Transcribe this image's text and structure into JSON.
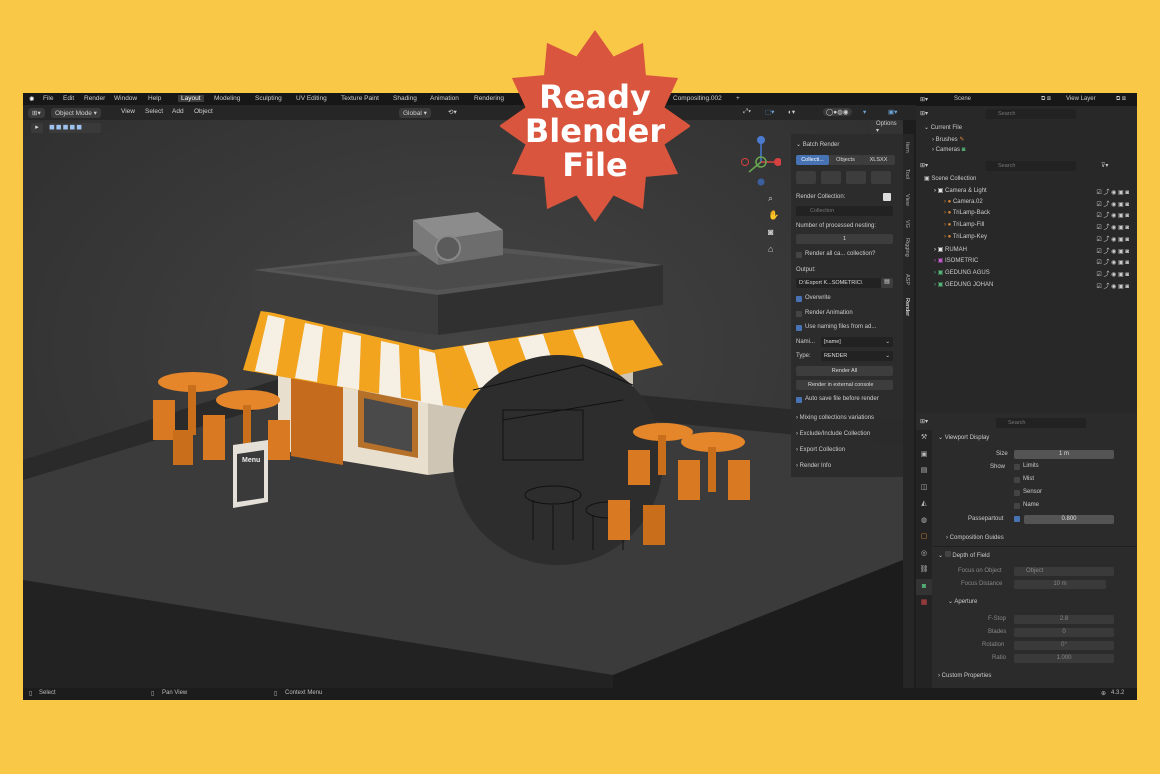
{
  "badge": {
    "line1": "Ready",
    "line2": "Blender",
    "line3": "File",
    "color": "#d9553d"
  },
  "menu": {
    "file": "File",
    "edit": "Edit",
    "render": "Render",
    "window": "Window",
    "help": "Help"
  },
  "workspaces": [
    "Layout",
    "Modeling",
    "Sculpting",
    "UV Editing",
    "Texture Paint",
    "Shading",
    "Animation",
    "Rendering",
    "Compositing.002"
  ],
  "scene": {
    "label": "Scene",
    "view_layer": "View Layer"
  },
  "viewport_header": {
    "mode": "Object Mode",
    "view": "View",
    "select": "Select",
    "add": "Add",
    "object": "Object",
    "transform": "Global",
    "options": "Options"
  },
  "batch": {
    "title": "Batch Render",
    "tabs": [
      "Collecti...",
      "Objects",
      "XLSXX"
    ],
    "render_collection_label": "Render Collection:",
    "collection_placeholder": "Collection",
    "nesting_label": "Number of processed nesting:",
    "nesting_value": "1",
    "render_all_label": "Render all ca... collection?",
    "output_label": "Output:",
    "output_value": "D:\\Export K...SOMETRIC\\",
    "overwrite": "Overwrite",
    "render_animation": "Render Animation",
    "naming_files": "Use naming files from ad...",
    "naming_label": "Nami...",
    "naming_value": "[name]",
    "type_label": "Type:",
    "type_value": "RENDER",
    "render_all_btn": "Render All",
    "render_external_btn": "Render in external console",
    "auto_save": "Auto save file before render",
    "sections": [
      "Mixing collections variations",
      "Exclude/Include Collection",
      "Export Collection",
      "Render Info"
    ]
  },
  "side_tabs": [
    "Item",
    "Tool",
    "View",
    "VG",
    "Rigging",
    "ASP",
    "Render"
  ],
  "outliner_top": {
    "root": "Current File",
    "items": [
      "Brushes",
      "Cameras"
    ],
    "search": "Search"
  },
  "outliner": {
    "search": "Search",
    "root": "Scene Collection",
    "rows": [
      {
        "label": "Camera & Light",
        "indent": 1
      },
      {
        "label": "Camera.02",
        "indent": 2
      },
      {
        "label": "TriLamp-Back",
        "indent": 2
      },
      {
        "label": "TriLamp-Fill",
        "indent": 2
      },
      {
        "label": "TriLamp-Key",
        "indent": 2
      },
      {
        "label": "RUMAH",
        "indent": 1
      },
      {
        "label": "ISOMETRIC",
        "indent": 1
      },
      {
        "label": "GEDUNG AGUS",
        "indent": 1
      },
      {
        "label": "GEDUNG JOHAN",
        "indent": 1
      }
    ]
  },
  "properties": {
    "search": "Search",
    "viewport_display": "Viewport Display",
    "size_label": "Size",
    "size_value": "1 m",
    "show_label": "Show",
    "limits": "Limits",
    "mist": "Mist",
    "sensor": "Sensor",
    "name": "Name",
    "passepartout_label": "Passepartout",
    "passepartout_value": "0.800",
    "composition_guides": "Composition Guides",
    "dof": "Depth of Field",
    "focus_object_label": "Focus on Object",
    "focus_object_value": "Object",
    "focus_distance_label": "Focus Distance",
    "focus_distance_value": "10 m",
    "aperture": "Aperture",
    "fstop_label": "F-Stop",
    "fstop_value": "2.8",
    "blades_label": "Blades",
    "blades_value": "0",
    "rotation_label": "Rotation",
    "rotation_value": "0°",
    "ratio_label": "Ratio",
    "ratio_value": "1.000",
    "custom_properties": "Custom Properties"
  },
  "sign_text": "Menu",
  "status": {
    "select": "Select",
    "pan": "Pan View",
    "context": "Context Menu",
    "version": "4.3.2"
  }
}
